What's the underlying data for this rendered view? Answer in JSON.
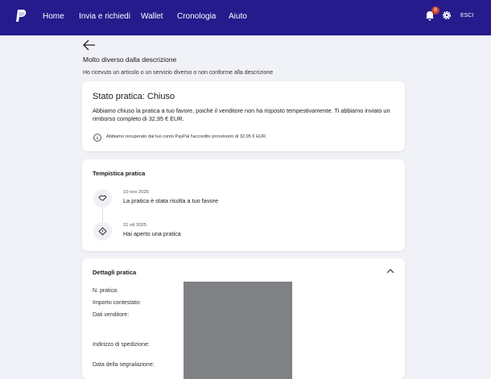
{
  "nav": {
    "items": [
      "Home",
      "Invia e richiedi",
      "Wallet",
      "Cronologia",
      "Aiuto"
    ],
    "notifications": "8",
    "logout": "ESCI"
  },
  "page": {
    "title": "Molto diverso dalla descrizione",
    "subtitle": "Ho ricevuto un articolo o un servizio diverso o non conforme alla descrizione"
  },
  "status": {
    "title": "Stato pratica: Chiuso",
    "body": "Abbiamo chiuso la pratica a tuo favore, poiché il venditore non ha risposto tempestivamente. Ti abbiamo inviato un rimborso completo di 32,95 € EUR.",
    "info": "Abbiamo recuperato dal tuo conto PayPal l'accredito provvisorio di 32,95 € EUR."
  },
  "timeline": {
    "title": "Tempistica pratica",
    "events": [
      {
        "date": "10 nov 2025",
        "text": "La pratica è stata risolta a tuo favore",
        "icon": "handshake-icon"
      },
      {
        "date": "31 ott 2025",
        "text": "Hai aperto una pratica",
        "icon": "warning-diamond-icon"
      }
    ]
  },
  "details": {
    "title": "Dettagli pratica",
    "labels": [
      "N. pratica:",
      "Importo contestato:",
      "Dati venditore:",
      "Indirizzo di spedizione:",
      "Data della segnalazione:"
    ]
  },
  "colors": {
    "nav": "#251b8c",
    "badge": "#c5452f",
    "background": "#f1f2f7",
    "redaction": "#808184"
  }
}
